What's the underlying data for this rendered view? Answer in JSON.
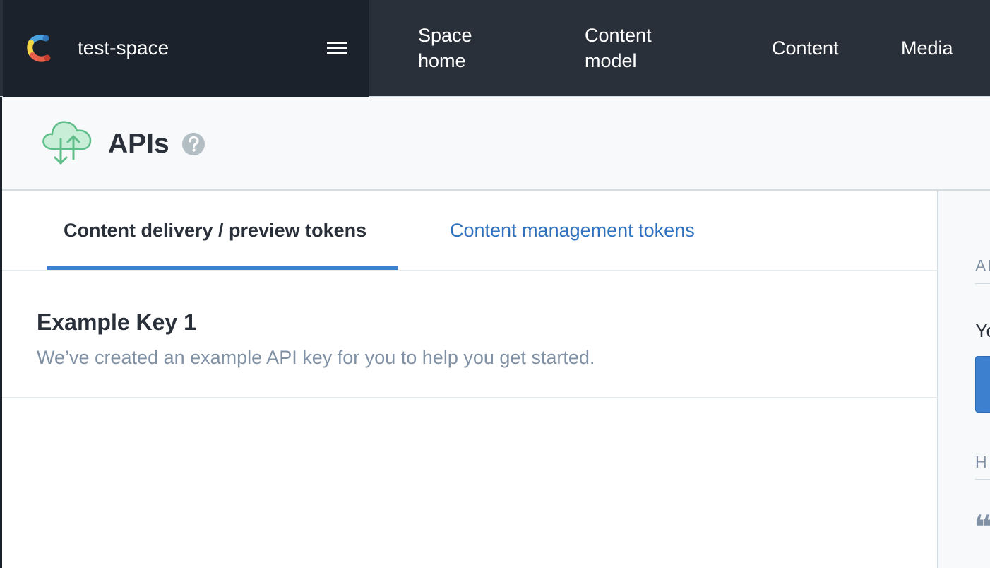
{
  "space": {
    "name": "test-space"
  },
  "nav": {
    "items": [
      {
        "label": "Space home"
      },
      {
        "label": "Content model"
      },
      {
        "label": "Content"
      },
      {
        "label": "Media"
      }
    ]
  },
  "page": {
    "title": "APIs"
  },
  "tabs": [
    {
      "label": "Content delivery / preview tokens",
      "active": true
    },
    {
      "label": "Content management tokens",
      "active": false
    }
  ],
  "api_keys": [
    {
      "name": "Example Key 1",
      "description": "We’ve created an example API key for you to help you get started."
    }
  ],
  "sidebar": {
    "heading_1": "AI",
    "text": "Yo",
    "heading_2": "H",
    "quote_mark": "❝"
  },
  "colors": {
    "topbar": "#2a3039",
    "switcher": "#1b222c",
    "accent_blue": "#3c80cf",
    "link_blue": "#3072be",
    "muted_text": "#8091a5",
    "brand_green": "#5fbe8a"
  },
  "icons": {
    "logo": "contentful-logo",
    "menu": "hamburger-icon",
    "page": "cloud-upload-download-icon",
    "help": "question-circle-icon"
  }
}
